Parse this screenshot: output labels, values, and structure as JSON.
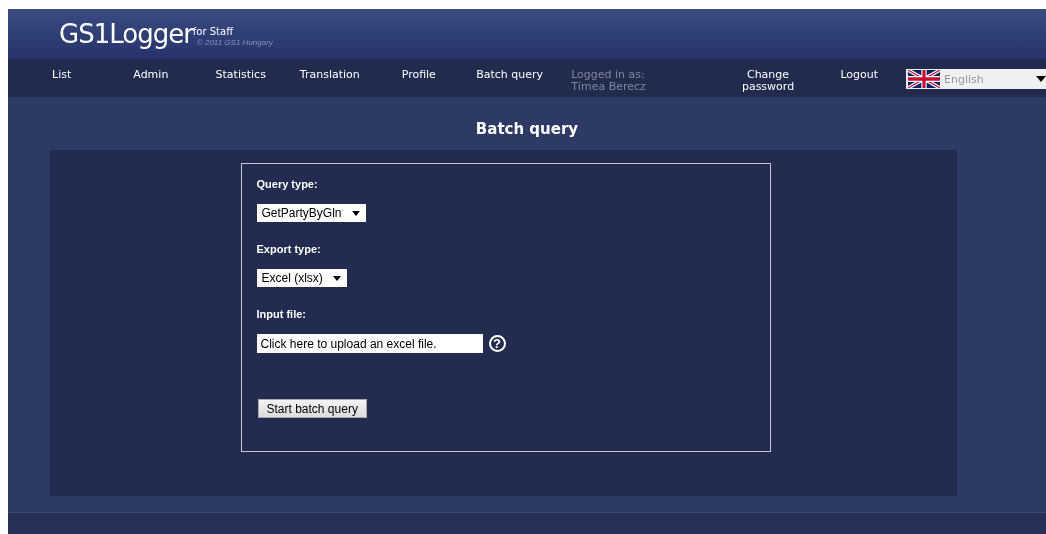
{
  "logo": {
    "name": "GS1Logger",
    "suffix": "for Staff",
    "copyright": "© 2011 GS1 Hungary"
  },
  "nav": [
    {
      "label": "List"
    },
    {
      "label": "Admin"
    },
    {
      "label": "Statistics"
    },
    {
      "label": "Translation"
    },
    {
      "label": "Profile"
    },
    {
      "label": "Batch query"
    }
  ],
  "login": {
    "label": "Logged in as:",
    "user": "Tímea Berecz"
  },
  "actions": [
    {
      "label": "Change password"
    },
    {
      "label": "Logout"
    }
  ],
  "language": {
    "label": "English"
  },
  "page_title": "Batch query",
  "form": {
    "query_label": "Query type:",
    "query_value": "GetPartyByGln",
    "export_label": "Export type:",
    "export_value": "Excel (xlsx)",
    "file_label": "Input file:",
    "file_placeholder": "Click here to upload an excel file.",
    "help": "?",
    "submit": "Start batch query"
  }
}
